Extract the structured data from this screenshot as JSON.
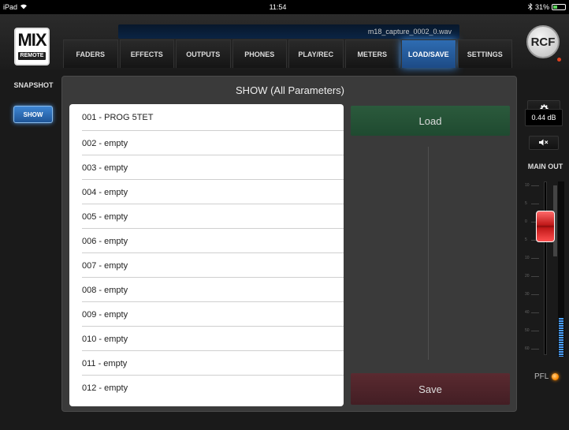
{
  "status_bar": {
    "device": "iPad",
    "wifi_icon": "wifi-icon",
    "time": "11:54",
    "battery_text": "31%"
  },
  "header": {
    "logo_main": "MIX",
    "logo_sub": "REMOTE",
    "filename": "m18_capture_0002_0.wav",
    "brand": "RCF"
  },
  "tabs": [
    {
      "label": "FADERS",
      "active": false
    },
    {
      "label": "EFFECTS",
      "active": false
    },
    {
      "label": "OUTPUTS",
      "active": false
    },
    {
      "label": "PHONES",
      "active": false
    },
    {
      "label": "PLAY/REC",
      "active": false
    },
    {
      "label": "METERS",
      "active": false
    },
    {
      "label": "LOAD/SAVE",
      "active": true
    },
    {
      "label": "SETTINGS",
      "active": false
    }
  ],
  "sidebar": {
    "snapshot_label": "SNAPSHOT",
    "show_button": "SHOW"
  },
  "main": {
    "title": "SHOW (All Parameters)",
    "items": [
      "001 - PROG 5TET",
      "002 - empty",
      "003 - empty",
      "004 - empty",
      "005 - empty",
      "006 - empty",
      "007 - empty",
      "008 - empty",
      "009 - empty",
      "010 - empty",
      "011 - empty",
      "012 - empty"
    ],
    "load_label": "Load",
    "save_label": "Save"
  },
  "right_panel": {
    "gear_icon": "gear-icon",
    "level_display": "0.44 dB",
    "mute_icon": "speaker-mute-icon",
    "main_out_label": "MAIN OUT",
    "pfl_label": "PFL",
    "fader_ticks": [
      "10",
      "5",
      "0",
      "5",
      "10",
      "20",
      "30",
      "40",
      "50",
      "60"
    ],
    "fader_position_db": 0.44,
    "meter_level_fraction": 0.22
  },
  "colors": {
    "active_tab": "#2e6cb2",
    "load_button": "#2b5a3c",
    "save_button": "#5a2a30",
    "fader_cap": "#c01818",
    "pfl_led": "#ff8a00"
  }
}
